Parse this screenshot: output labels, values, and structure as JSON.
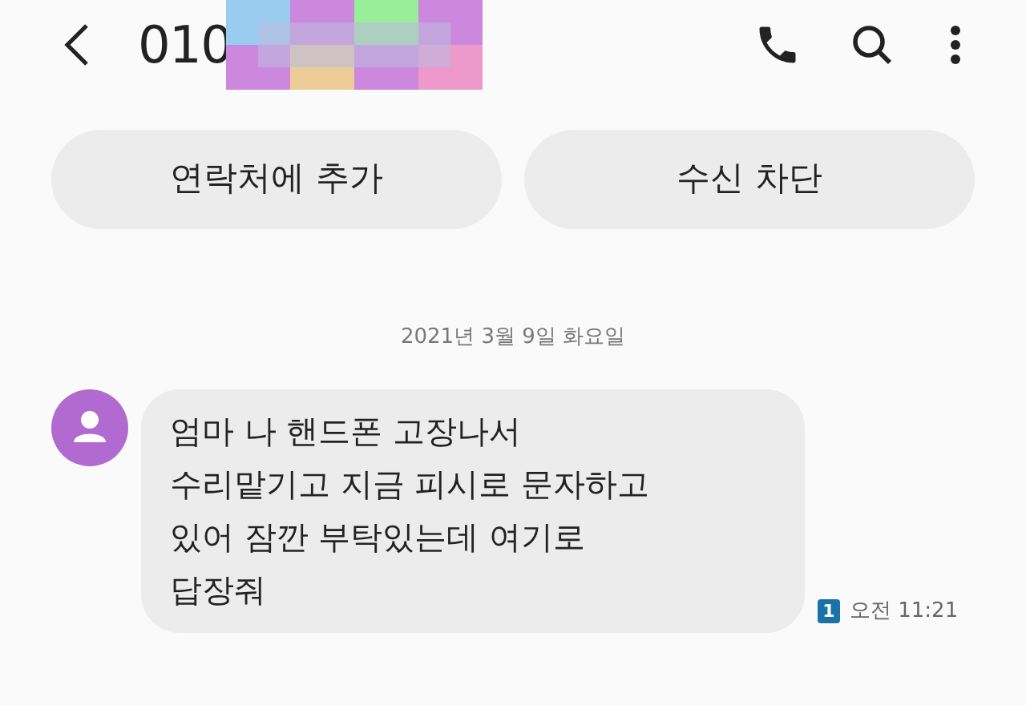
{
  "header": {
    "title": "010"
  },
  "buttons": [
    "연락처에 추가",
    "수신 차단"
  ],
  "date": "2021년 3월 9일 화요일",
  "messages": [
    {
      "lines": [
        "엄마 나 핸드폰 고장나서",
        "수리맡기고 지금 피시로 문자하고",
        "있어 잠깐 부탁있는데 여기로",
        "답장줘"
      ],
      "sim": "1",
      "time": "오전 11:21"
    }
  ]
}
